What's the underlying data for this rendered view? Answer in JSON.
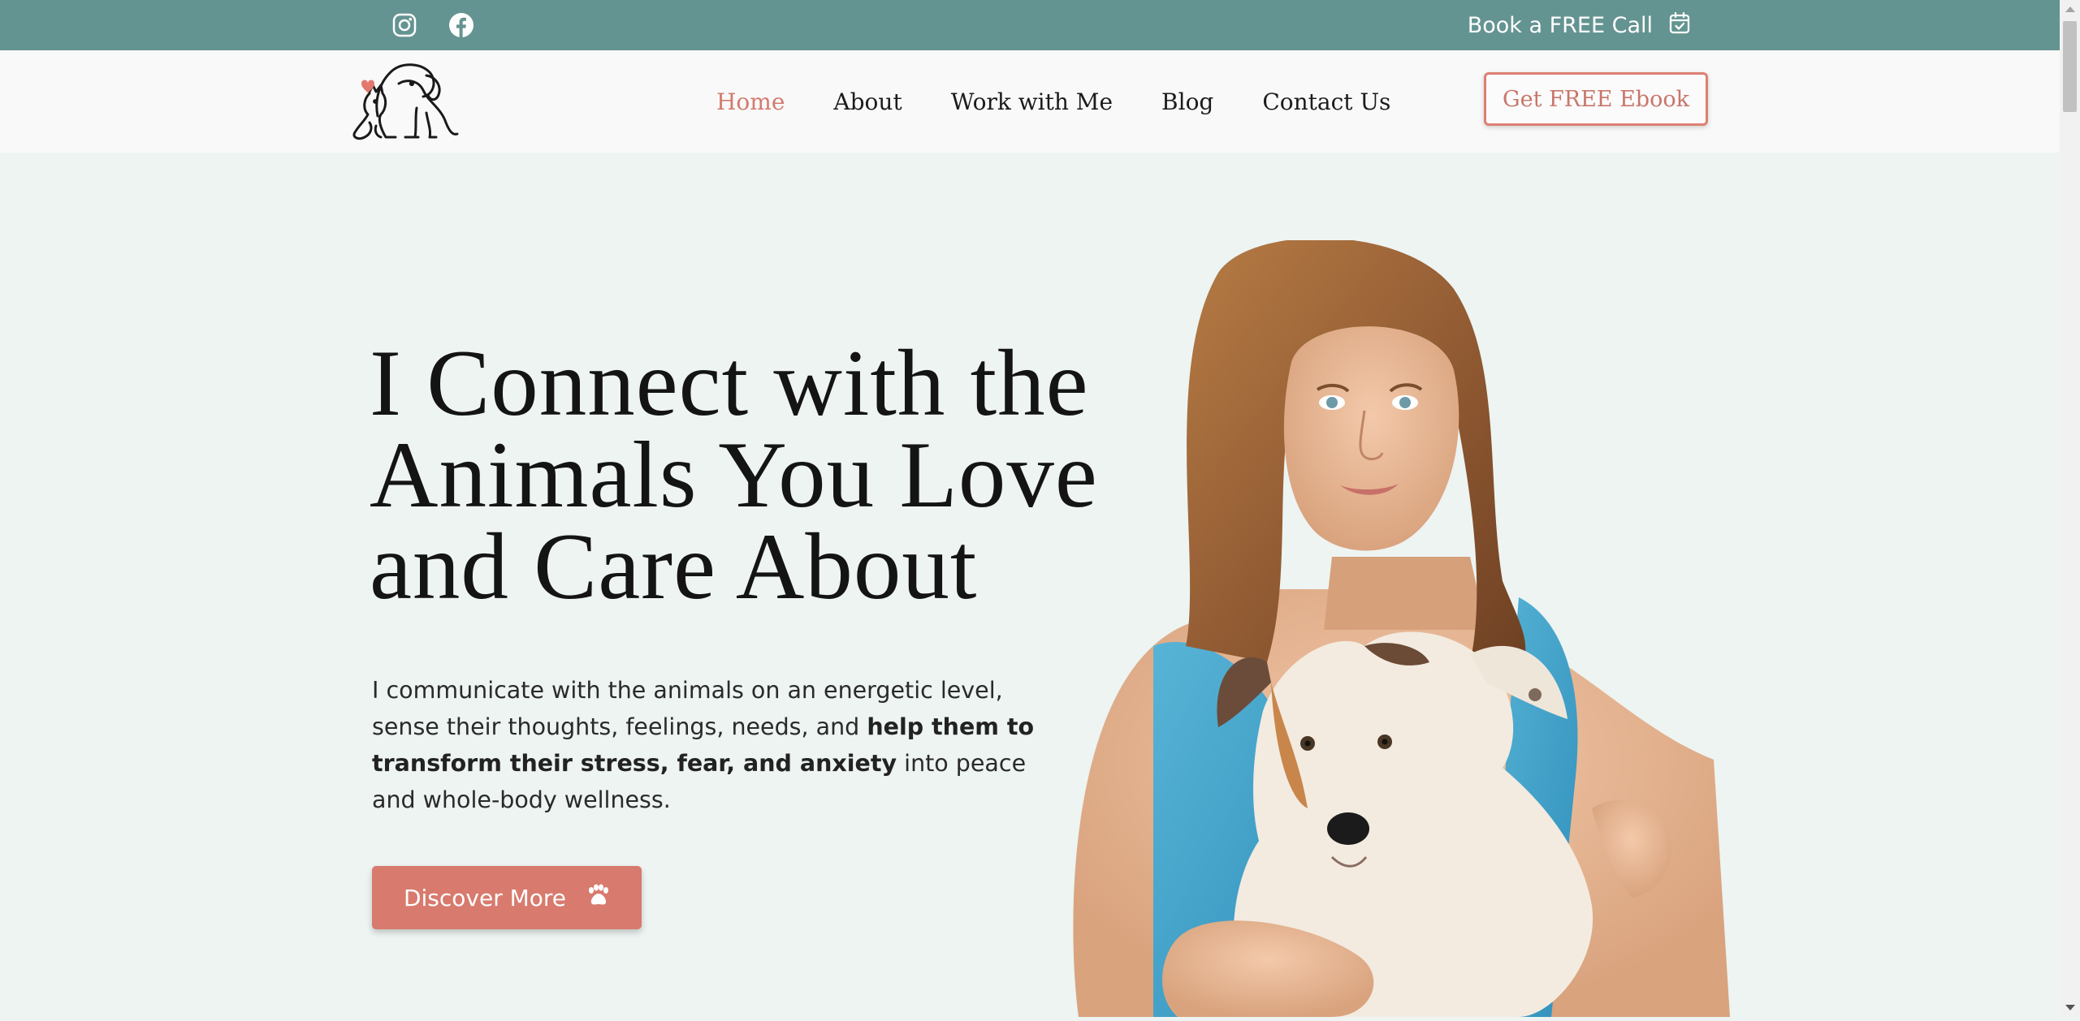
{
  "topbar": {
    "social": [
      {
        "icon": "instagram-icon"
      },
      {
        "icon": "facebook-icon"
      }
    ],
    "book_call_label": "Book a FREE Call",
    "book_call_icon": "calendar-check-icon"
  },
  "nav": {
    "logo": "dog-and-cat-heart-logo",
    "links": [
      {
        "label": "Home",
        "active": true
      },
      {
        "label": "About",
        "active": false
      },
      {
        "label": "Work with Me",
        "active": false
      },
      {
        "label": "Blog",
        "active": false
      },
      {
        "label": "Contact Us",
        "active": false
      }
    ],
    "cta_label": "Get FREE Ebook"
  },
  "hero": {
    "title_lines": [
      "I Connect with the",
      "Animals You Love",
      "and Care About"
    ],
    "text_parts": [
      "I communicate with the animals on an energetic level, sense their thoughts, feelings, needs, and ",
      "help them to transform their stress, fear, and anxiety",
      " into peace and whole-body wellness."
    ],
    "button_label": "Discover More",
    "button_icon": "paw-icon"
  },
  "colors": {
    "topbar": "#649492",
    "accent": "#d87a6d",
    "page_bg": "#edf4f2",
    "nav_bg": "#f9f9f9"
  }
}
